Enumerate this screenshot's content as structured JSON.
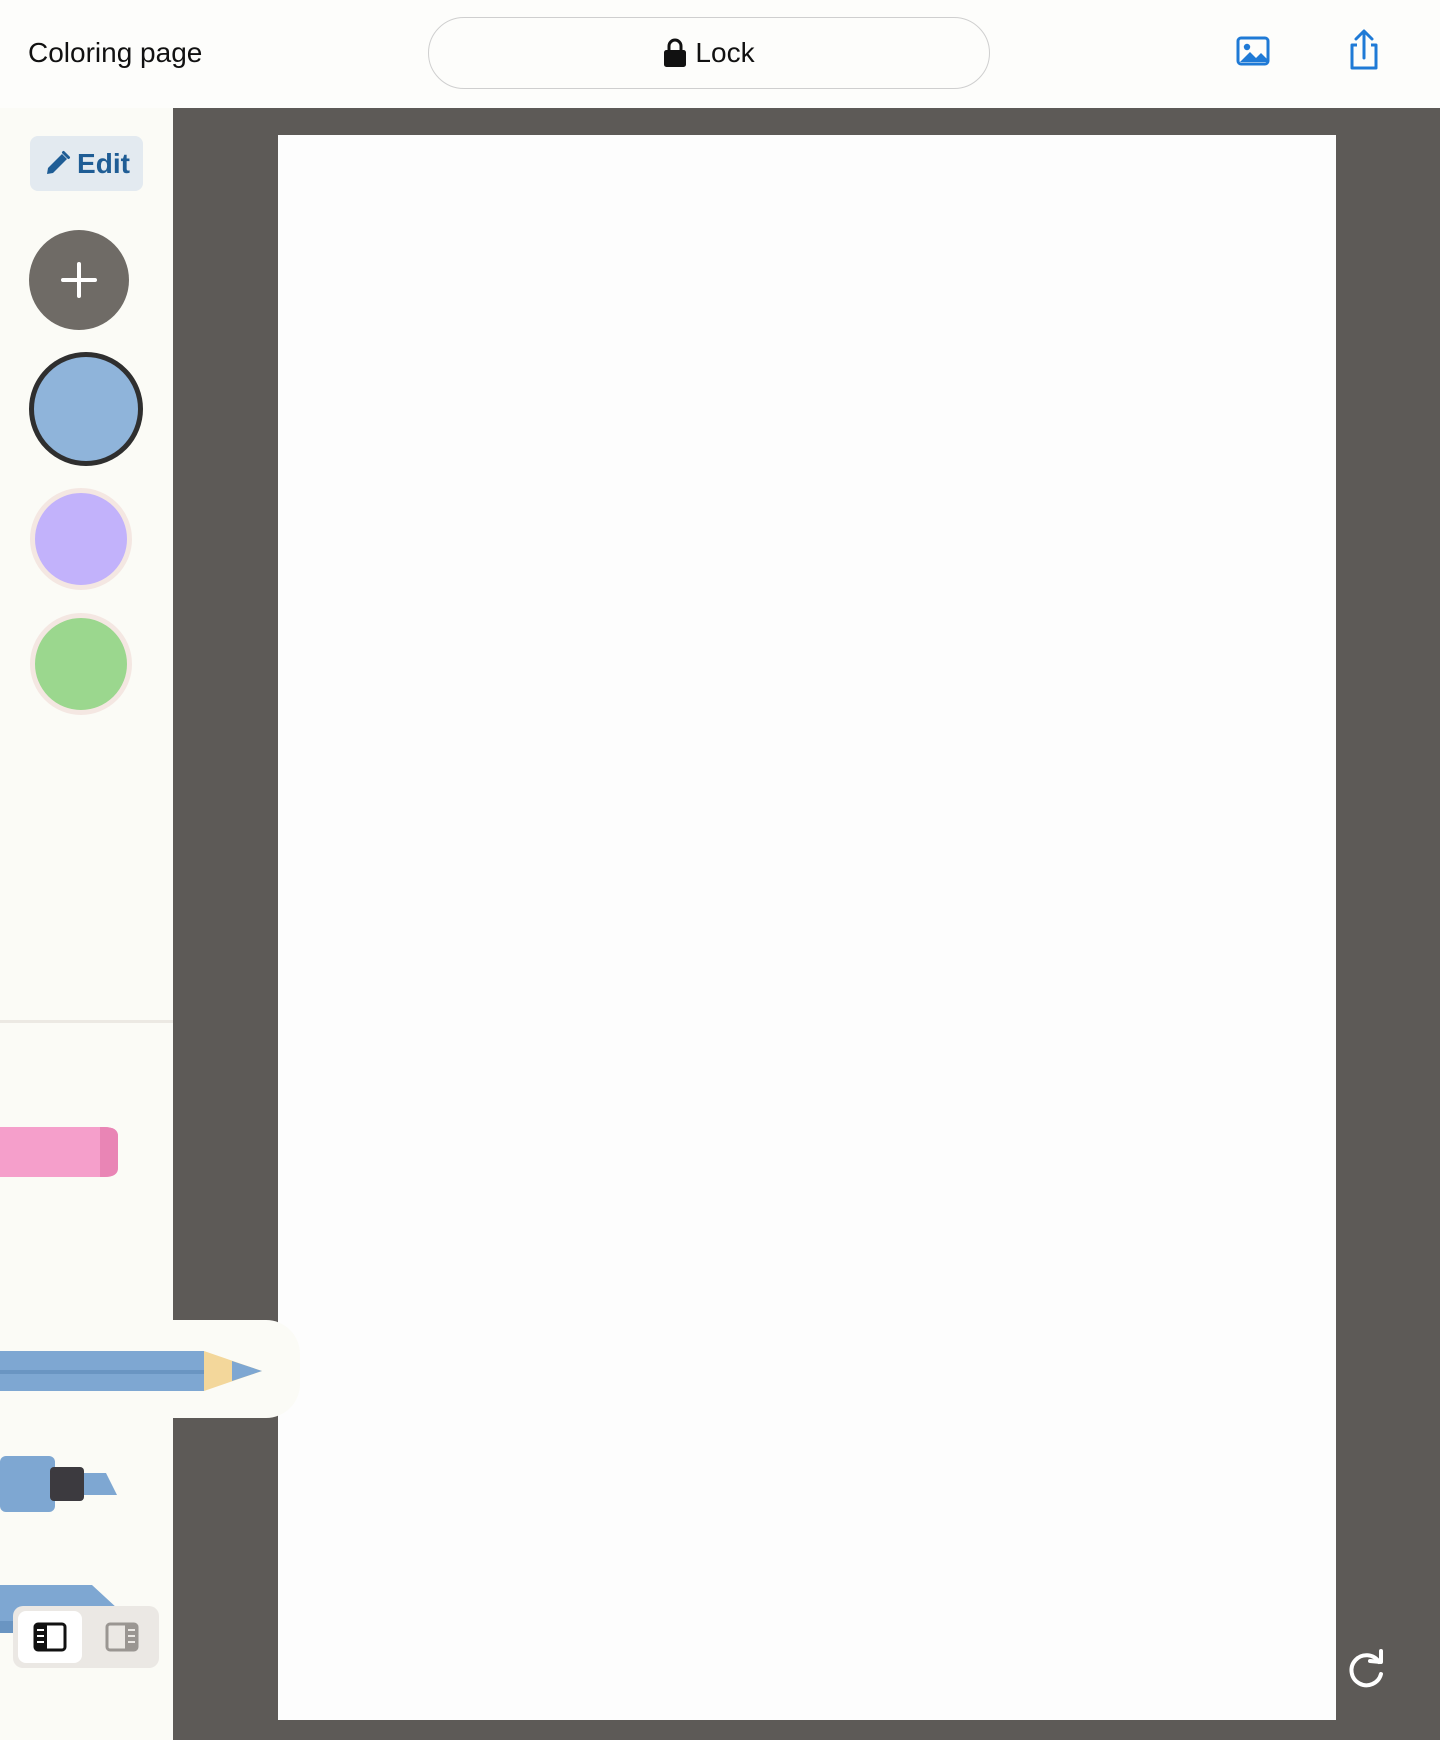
{
  "header": {
    "title": "Coloring page",
    "lock_label": "Lock",
    "image_icon": "image-icon",
    "share_icon": "share-upload-icon"
  },
  "sidebar": {
    "edit_label": "Edit",
    "edit_icon": "pencil-icon",
    "add_color_icon": "plus-icon",
    "swatches": [
      {
        "color": "#8fb4da",
        "selected": true
      },
      {
        "color": "#c2b2fb",
        "selected": false
      },
      {
        "color": "#9bd78e",
        "selected": false
      }
    ],
    "tools": [
      {
        "name": "eraser",
        "color": "#f59fcb"
      },
      {
        "name": "pencil",
        "color": "#7ea7d2",
        "selected": true
      },
      {
        "name": "marker",
        "color": "#7ea7d2"
      },
      {
        "name": "crayon",
        "color": "#7ea7d2"
      }
    ],
    "layout_options": [
      {
        "icon": "sidebar-left-icon",
        "active": true
      },
      {
        "icon": "sidebar-right-icon",
        "active": false
      }
    ]
  },
  "canvas": {
    "workspace_color": "#5d5a57",
    "paper_color": "#fdfdfd",
    "redo_icon": "redo-icon"
  },
  "colors": {
    "accent": "#1f7ad6",
    "edit_text": "#1f5d95"
  }
}
